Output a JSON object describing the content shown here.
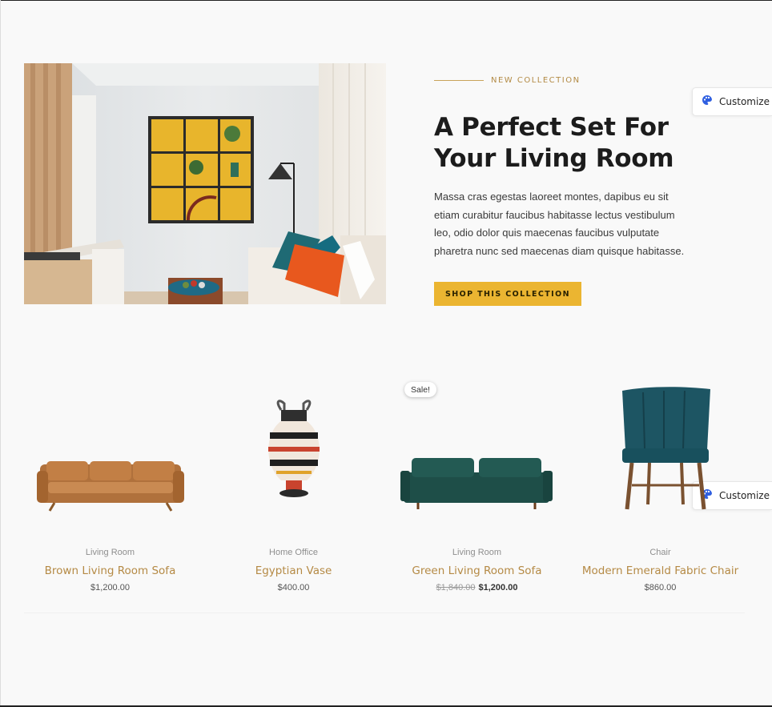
{
  "hero": {
    "eyebrow": "NEW COLLECTION",
    "title": "A Perfect Set For Your Living Room",
    "description": "Massa cras egestas laoreet montes, dapibus eu sit etiam curabitur faucibus habitasse lectus vestibulum leo, odio dolor quis maecenas faucibus vulputate pharetra nunc sed maecenas diam quisque habitasse.",
    "button_label": "SHOP THIS COLLECTION"
  },
  "customize": {
    "label": "Customize",
    "icon": "palette-icon"
  },
  "sale_badge": "Sale!",
  "products": [
    {
      "category": "Living Room",
      "name": "Brown Living Room Sofa",
      "price": "$1,200.00"
    },
    {
      "category": "Home Office",
      "name": "Egyptian Vase",
      "price": "$400.00"
    },
    {
      "category": "Living Room",
      "name": "Green Living Room Sofa",
      "old_price": "$1,840.00",
      "price": "$1,200.00"
    },
    {
      "category": "Chair",
      "name": "Modern Emerald Fabric Chair",
      "price": "$860.00"
    }
  ],
  "colors": {
    "accent": "#ebb531",
    "product_name": "#b58a45",
    "eyebrow": "#b38b45",
    "customize_icon": "#2f5fe0"
  }
}
